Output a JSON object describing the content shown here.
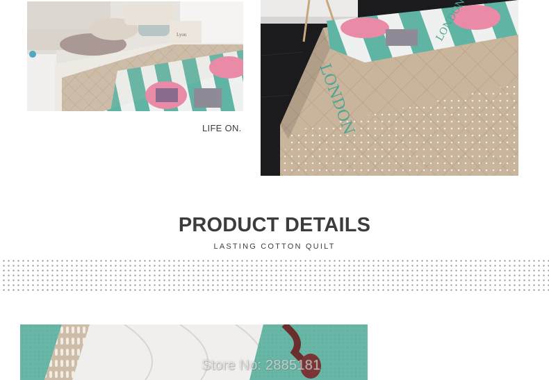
{
  "top": {
    "tagline": "LIFE ON.",
    "bedroom_photo_alt": "bedroom-photo",
    "quilt_photo_alt": "quilt-closeup-photo",
    "quilt_print_text": "LONDON"
  },
  "details": {
    "title": "PRODUCT DETAILS",
    "subtitle": "LASTING COTTON QUILT"
  },
  "detail_photo": {
    "watermark": "Store No: 2885181"
  },
  "colors": {
    "teal": "#5fb4a4",
    "beige": "#c8b49e",
    "pink": "#e98aa6",
    "text": "#3c3c3c"
  }
}
